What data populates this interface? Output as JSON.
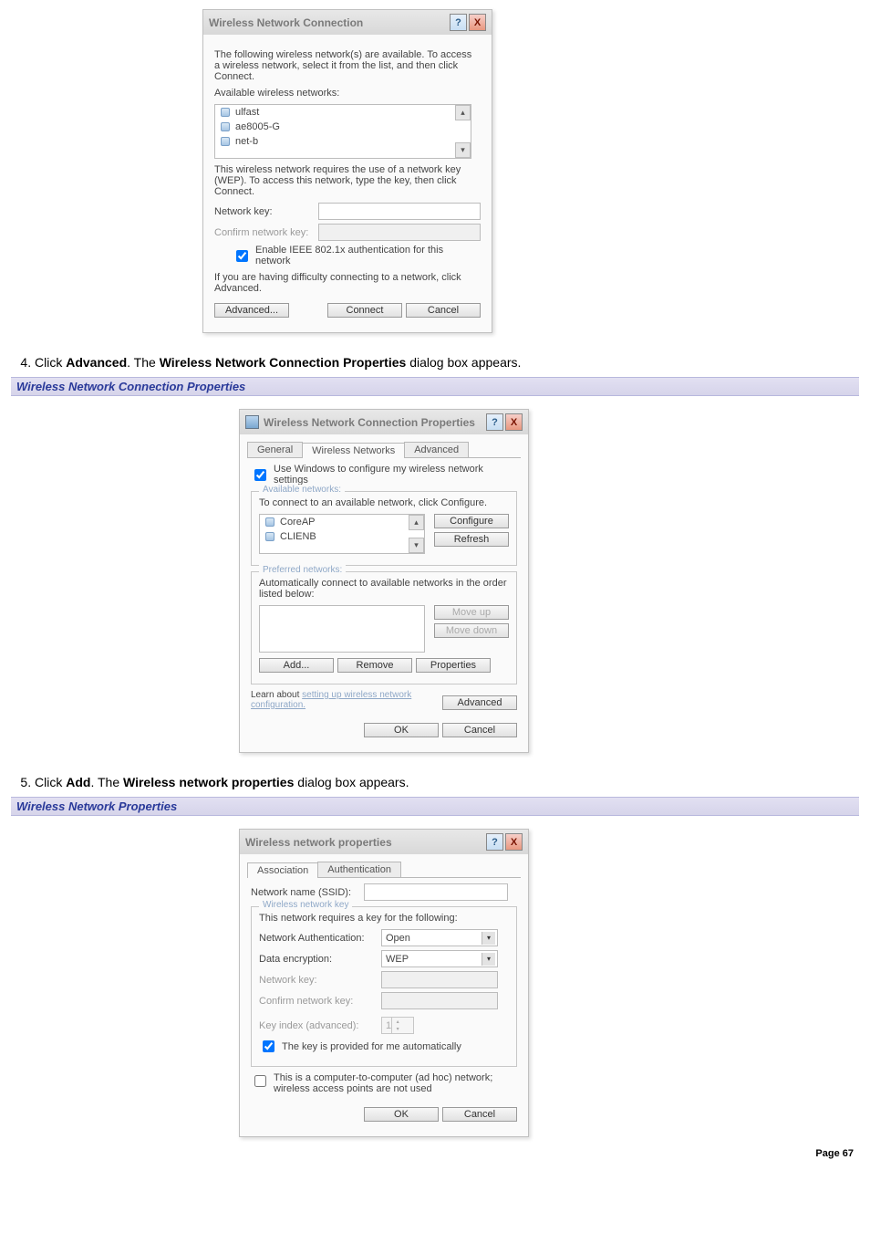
{
  "dlg1": {
    "title": "Wireless Network Connection",
    "intro": "The following wireless network(s) are available. To access a wireless network, select it from the list, and then click Connect.",
    "avail_label": "Available wireless networks:",
    "nets": [
      "ulfast",
      "ae8005-G",
      "net-b"
    ],
    "wep_msg": "This wireless network requires the use of a network key (WEP). To access this network, type the key, then click Connect.",
    "key_label": "Network key:",
    "confirm_label": "Confirm network key:",
    "enable_8021x": "Enable IEEE 802.1x authentication for this network",
    "difficulty": "If you are having difficulty connecting to a network, click Advanced.",
    "advanced_btn": "Advanced...",
    "connect_btn": "Connect",
    "cancel_btn": "Cancel"
  },
  "step4": {
    "num": "4.",
    "text_pre": "Click ",
    "b1": "Advanced",
    "mid": ". The ",
    "b2": "Wireless Network Connection Properties",
    "post": " dialog box appears."
  },
  "hdr2": "Wireless Network Connection Properties",
  "dlg2": {
    "title": "Wireless Network Connection Properties",
    "tabs": [
      "General",
      "Wireless Networks",
      "Advanced"
    ],
    "use_windows": "Use Windows to configure my wireless network settings",
    "avail_legend": "Available networks:",
    "avail_hint": "To connect to an available network, click Configure.",
    "avail_list": [
      "CoreAP",
      "CLIENB"
    ],
    "configure_btn": "Configure",
    "refresh_btn": "Refresh",
    "pref_legend": "Preferred networks:",
    "pref_hint": "Automatically connect to available networks in the order listed below:",
    "moveup": "Move up",
    "movedown": "Move down",
    "add": "Add...",
    "remove": "Remove",
    "props": "Properties",
    "learn_pre": "Learn about ",
    "learn_link": "setting up wireless network configuration.",
    "advanced": "Advanced",
    "ok": "OK",
    "cancel": "Cancel"
  },
  "step5": {
    "num": "5.",
    "text_pre": "Click ",
    "b1": "Add",
    "mid": ". The ",
    "b2": "Wireless network properties",
    "post": " dialog box appears."
  },
  "hdr3": "Wireless Network Properties",
  "dlg3": {
    "title": "Wireless network properties",
    "tabs": [
      "Association",
      "Authentication"
    ],
    "ssid_label": "Network name (SSID):",
    "wkey_legend": "Wireless network key",
    "wkey_hint": "This network requires a key for the following:",
    "auth_label": "Network Authentication:",
    "auth_val": "Open",
    "enc_label": "Data encryption:",
    "enc_val": "WEP",
    "netkey": "Network key:",
    "confirm": "Confirm network key:",
    "keyidx": "Key index (advanced):",
    "keyidx_val": "1",
    "auto_key": "The key is provided for me automatically",
    "adhoc": "This is a computer-to-computer (ad hoc) network; wireless access points are not used",
    "ok": "OK",
    "cancel": "Cancel"
  },
  "footer": "Page 67"
}
